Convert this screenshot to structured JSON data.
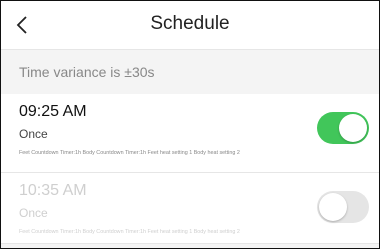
{
  "header": {
    "title": "Schedule",
    "back_icon": "chevron-left-icon"
  },
  "variance_text": "Time variance is  ±30s",
  "schedules": [
    {
      "time": "09:25 AM",
      "repeat": "Once",
      "details": "Feet Countdown Timer:1h Body Countdown Timer:1h Feet heat setting 1 Body heat setting 2",
      "enabled": true
    },
    {
      "time": "10:35 AM",
      "repeat": "Once",
      "details": "Feet Countdown Timer:1h Body Countdown Timer:1h Feet heat setting 1 Body heat setting 2",
      "enabled": false
    }
  ],
  "colors": {
    "toggle_on": "#41c65a",
    "toggle_off": "#e5e5e5"
  }
}
